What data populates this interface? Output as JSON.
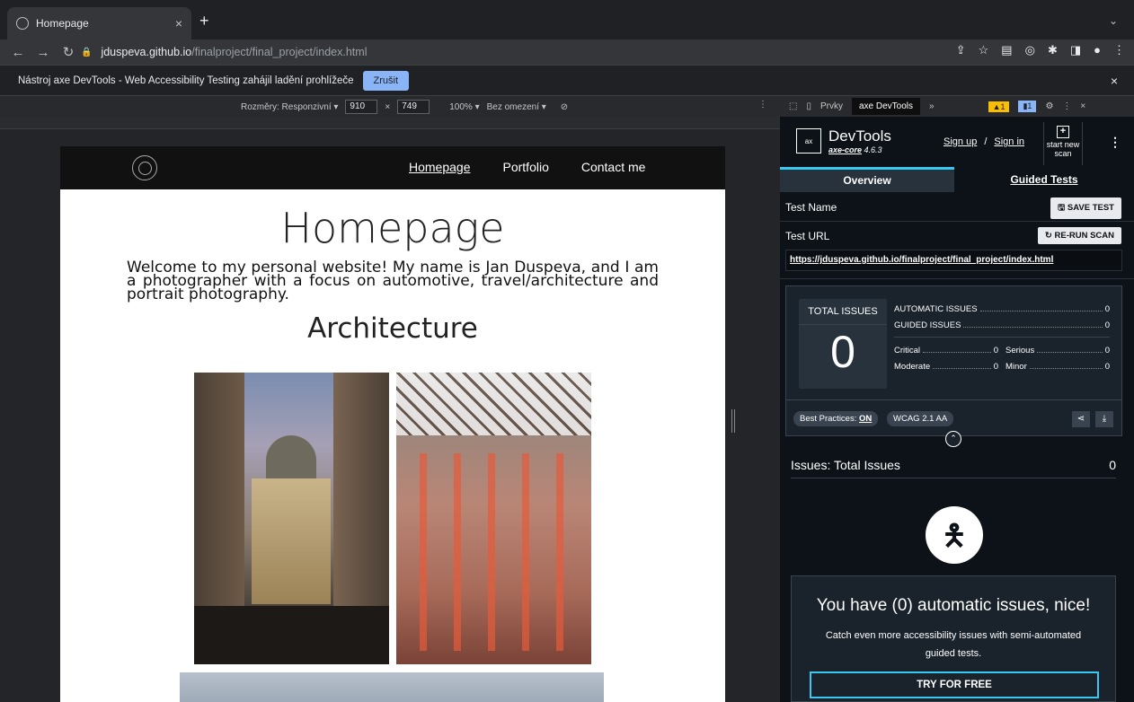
{
  "browser": {
    "tab_title": "Homepage",
    "url_host": "jduspeva.github.io",
    "url_path": "/finalproject/final_project/index.html"
  },
  "infobar": {
    "message": "Nástroj axe DevTools - Web Accessibility Testing zahájil ladění prohlížeče",
    "cancel_label": "Zrušit"
  },
  "device_toolbar": {
    "dimensions_label": "Rozměry: Responzivní ▾",
    "width": "910",
    "height": "749",
    "zoom": "100% ▾",
    "throttle": "Bez omezení ▾"
  },
  "page": {
    "nav": [
      "Homepage",
      "Portfolio",
      "Contact me"
    ],
    "title": "Homepage",
    "intro": "Welcome to my personal website! My name is Jan Duspeva, and I am a photographer with a focus on automotive, travel/architecture and portrait photography.",
    "section_title": "Architecture"
  },
  "devtools": {
    "tab_elements": "Prvky",
    "tab_axe": "axe DevTools",
    "more_tabs": "»",
    "warnings": "▲1",
    "messages": "▮1"
  },
  "axe": {
    "brand": "DevTools",
    "core_link": "axe-core",
    "core_version": "4.6.3",
    "sign_up": "Sign up",
    "slash": "/",
    "sign_in": "Sign in",
    "start_new": "start new scan",
    "tab_overview": "Overview",
    "tab_guided": "Guided Tests",
    "test_name_label": "Test Name",
    "save_test": "SAVE TEST",
    "test_url_label": "Test URL",
    "rerun": "RE-RUN SCAN",
    "test_url": "https://jduspeva.github.io/finalproject/final_project/index.html",
    "total_label": "TOTAL ISSUES",
    "total_value": "0",
    "automatic_label": "AUTOMATIC ISSUES",
    "automatic_value": "0",
    "guided_label": "GUIDED ISSUES",
    "guided_value": "0",
    "critical_label": "Critical",
    "critical_value": "0",
    "serious_label": "Serious",
    "serious_value": "0",
    "moderate_label": "Moderate",
    "moderate_value": "0",
    "minor_label": "Minor",
    "minor_value": "0",
    "best_practices": "Best Practices:",
    "best_practices_state": "ON",
    "standard": "WCAG 2.1 AA",
    "issues_heading": "Issues: Total Issues",
    "issues_count": "0",
    "card_heading": "You have (0) automatic issues, nice!",
    "card_text": "Catch even more accessibility issues with semi-automated guided tests.",
    "try_free": "TRY FOR FREE"
  },
  "colors": {
    "accent": "#3ac7f0",
    "panel_bg": "#0d1218"
  }
}
